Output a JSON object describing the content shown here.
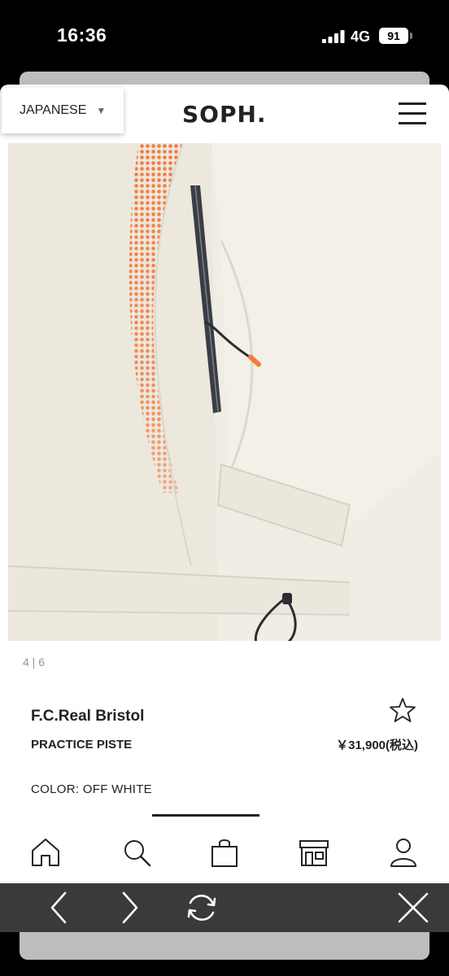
{
  "status_bar": {
    "time": "16:36",
    "network": "4G",
    "battery": "91"
  },
  "header": {
    "language": "JAPANESE",
    "logo": "SOPH."
  },
  "gallery": {
    "pager": "4 | 6"
  },
  "product": {
    "brand": "F.C.Real Bristol",
    "name": "PRACTICE PISTE",
    "price": "￥31,900(税込)",
    "color": "COLOR: OFF WHITE"
  },
  "tab_bar": {
    "items": [
      "home-icon",
      "search-icon",
      "bag-icon",
      "store-icon",
      "account-icon"
    ]
  },
  "browser_toolbar": {
    "items": [
      "back-icon",
      "forward-icon",
      "reload-icon",
      "close-icon"
    ]
  },
  "colors": {
    "accent_orange": "#f47a3c",
    "garment": "#f0ede4",
    "toolbar": "#3a3a3c"
  }
}
